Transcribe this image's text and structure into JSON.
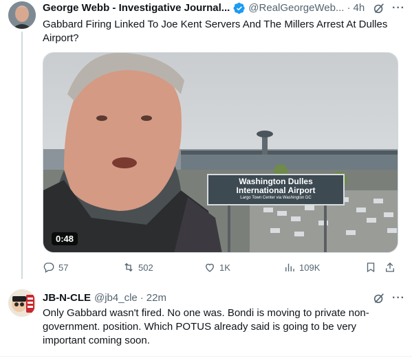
{
  "tweet": {
    "author_name": "George Webb - Investigative Journal...",
    "handle": "@RealGeorgeWeb...",
    "separator": "·",
    "time": "4h",
    "text": "Gabbard Firing Linked To Joe Kent Servers And The Millers Arrest At Dulles Airport?",
    "media": {
      "duration": "0:48",
      "sign_line1": "Washington Dulles",
      "sign_line2": "International Airport",
      "sign_line3": "Largo Town Center via Washington DC"
    },
    "actions": {
      "replies": "57",
      "reposts": "502",
      "likes": "1K",
      "views": "109K"
    },
    "icons": [
      "verified-badge-icon",
      "grok-icon",
      "more-icon",
      "reply-icon",
      "repost-icon",
      "like-icon",
      "views-icon",
      "bookmark-icon",
      "share-icon"
    ]
  },
  "reply": {
    "author_name": "JB-N-CLE",
    "handle": "@jb4_cle",
    "separator": "·",
    "time": "22m",
    "text": "Only Gabbard wasn't fired. No one was. Bondi is moving to private non-government. position. Which POTUS already said is going to be very important coming soon."
  },
  "colors": {
    "text_primary": "#0f1419",
    "text_secondary": "#536471",
    "verified_blue": "#1d9bf0",
    "divider": "#cfd9de"
  }
}
